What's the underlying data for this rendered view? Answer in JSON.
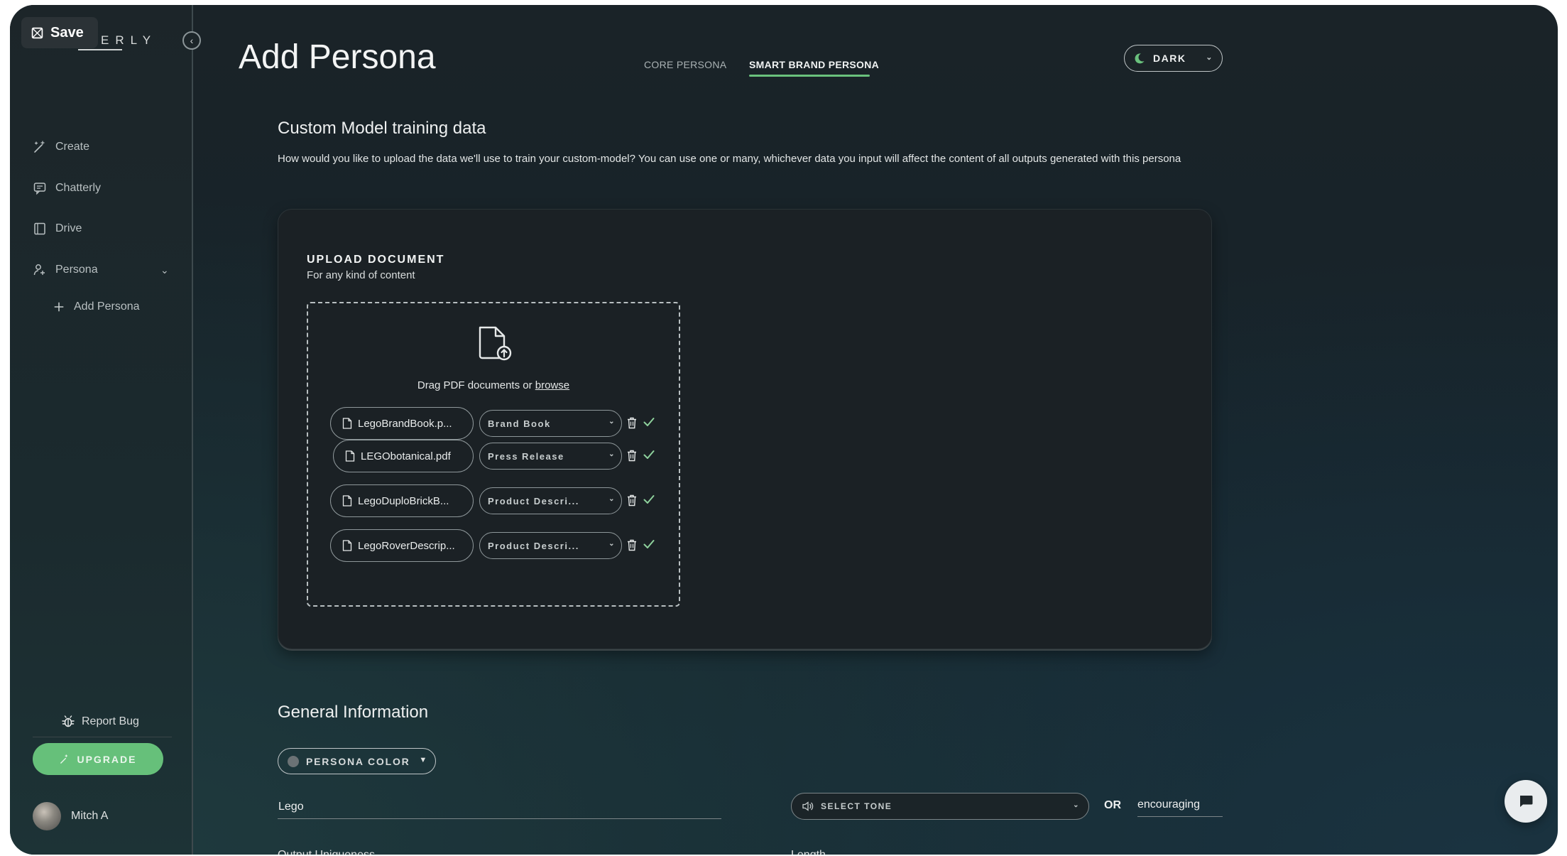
{
  "app": {
    "save_label": "Save",
    "brand_partial": "ERLY"
  },
  "sidebar": {
    "items": [
      {
        "label": "Create",
        "icon": "magic-wand-icon"
      },
      {
        "label": "Chatterly",
        "icon": "chat-icon"
      },
      {
        "label": "Drive",
        "icon": "drive-icon"
      },
      {
        "label": "Persona",
        "icon": "persona-icon"
      },
      {
        "label": "Add Persona",
        "icon": "plus-icon"
      }
    ],
    "report_bug": "Report Bug",
    "upgrade": "UPGRADE",
    "user_name": "Mitch A"
  },
  "header": {
    "title": "Add Persona",
    "tabs": [
      {
        "label": "CORE PERSONA",
        "active": false
      },
      {
        "label": "SMART BRAND PERSONA",
        "active": true
      }
    ],
    "theme": "DARK"
  },
  "training": {
    "title": "Custom Model training data",
    "description": "How would you like to upload the data we'll use to train your custom-model? You can use one or many, whichever data you input will affect the content of all outputs generated with this persona",
    "upload_heading": "UPLOAD DOCUMENT",
    "upload_sub": "For any kind of content",
    "drag_text": "Drag PDF documents or ",
    "browse_link": "browse",
    "files": [
      {
        "name": "LegoBrandBook.p...",
        "type": "Brand Book"
      },
      {
        "name": "LEGObotanical.pdf",
        "type": "Press Release"
      },
      {
        "name": "LegoDuploBrickB...",
        "type": "Product Descri..."
      },
      {
        "name": "LegoRoverDescrip...",
        "type": "Product Descri..."
      }
    ]
  },
  "general": {
    "title": "General Information",
    "persona_color_label": "PERSONA COLOR",
    "name_value": "Lego",
    "tone_placeholder": "SELECT TONE",
    "or_label": "OR",
    "tone_value": "encouraging",
    "output_uniqueness_label": "Output Uniqueness",
    "length_label": "Length"
  },
  "colors": {
    "accent": "#6ac17d",
    "background": "#1a2328",
    "card": "#1b2125"
  }
}
